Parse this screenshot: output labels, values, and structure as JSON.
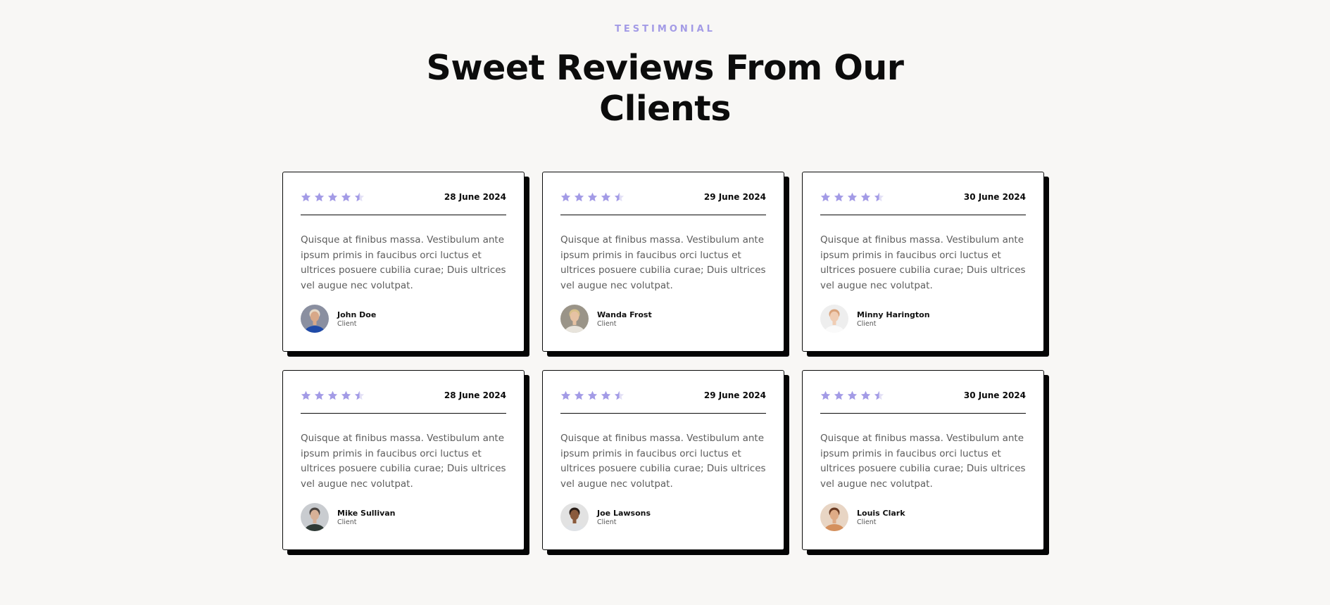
{
  "section": {
    "eyebrow": "TESTIMONIAL",
    "title": "Sweet Reviews From Our Clients"
  },
  "colors": {
    "accent": "#a39be6",
    "background": "#f8f7f5",
    "card_border": "#0a0a0a",
    "text_muted": "#5c5c5c"
  },
  "testimonials": [
    {
      "rating": 4.5,
      "date": "28 June 2024",
      "text": "Quisque at finibus massa. Vestibulum ante ipsum primis in faucibus orci luctus et ultrices posuere cubilia curae; Duis ultrices vel augue nec volutpat.",
      "author": "John Doe",
      "role": "Client",
      "avatar": {
        "bg": "#8a8fa0",
        "skin": "#d8a888",
        "hair": "#e5d9c8",
        "shirt": "#1f4aa8"
      }
    },
    {
      "rating": 4.5,
      "date": "29 June 2024",
      "text": "Quisque at finibus massa. Vestibulum ante ipsum primis in faucibus orci luctus et ultrices posuere cubilia curae; Duis ultrices vel augue nec volutpat.",
      "author": "Wanda Frost",
      "role": "Client",
      "avatar": {
        "bg": "#9a9488",
        "skin": "#e6c2a3",
        "hair": "#d8c08a",
        "shirt": "#e8e4dc"
      }
    },
    {
      "rating": 4.5,
      "date": "30 June 2024",
      "text": "Quisque at finibus massa. Vestibulum ante ipsum primis in faucibus orci luctus et ultrices posuere cubilia curae; Duis ultrices vel augue nec volutpat.",
      "author": "Minny Harington",
      "role": "Client",
      "avatar": {
        "bg": "#eeeeee",
        "skin": "#f0cdb4",
        "hair": "#d9a27a",
        "shirt": "#fafafa"
      }
    },
    {
      "rating": 4.5,
      "date": "28 June 2024",
      "text": "Quisque at finibus massa. Vestibulum ante ipsum primis in faucibus orci luctus et ultrices posuere cubilia curae; Duis ultrices vel augue nec volutpat.",
      "author": "Mike Sullivan",
      "role": "Client",
      "avatar": {
        "bg": "#c9ccd0",
        "skin": "#d7b197",
        "hair": "#4a4440",
        "shirt": "#2f3a36"
      }
    },
    {
      "rating": 4.5,
      "date": "29 June 2024",
      "text": "Quisque at finibus massa. Vestibulum ante ipsum primis in faucibus orci luctus et ultrices posuere cubilia curae; Duis ultrices vel augue nec volutpat.",
      "author": "Joe Lawsons",
      "role": "Client",
      "avatar": {
        "bg": "#e2e2e2",
        "skin": "#8a5a3c",
        "hair": "#2a1e18",
        "shirt": "#dfe2e6"
      }
    },
    {
      "rating": 4.5,
      "date": "30 June 2024",
      "text": "Quisque at finibus massa. Vestibulum ante ipsum primis in faucibus orci luctus et ultrices posuere cubilia curae; Duis ultrices vel augue nec volutpat.",
      "author": "Louis Clark",
      "role": "Client",
      "avatar": {
        "bg": "#e8d5c4",
        "skin": "#dfab86",
        "hair": "#6a3a22",
        "shirt": "#d4905e"
      }
    }
  ]
}
